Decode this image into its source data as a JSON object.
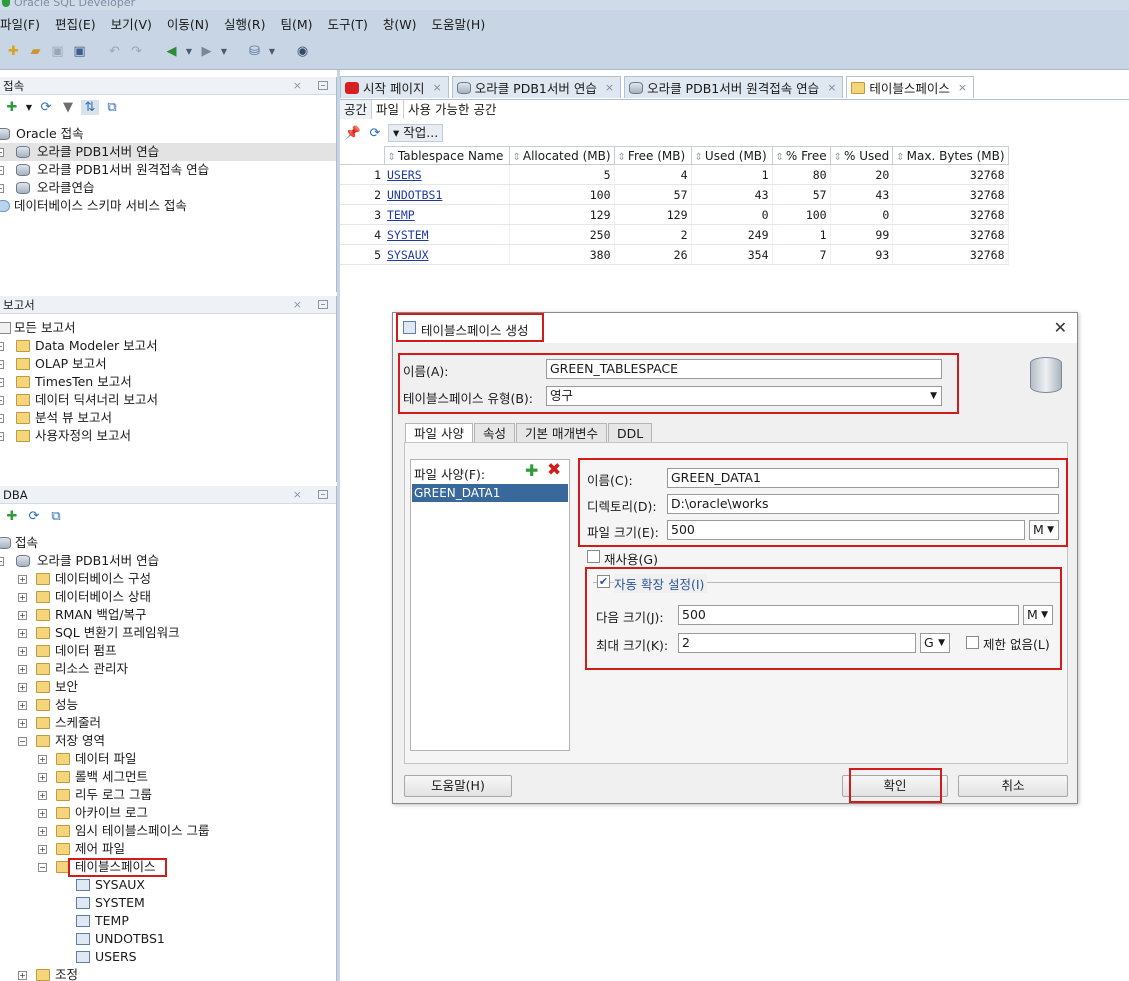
{
  "window": {
    "title": "Oracle SQL Developer"
  },
  "menu": [
    "파일(F)",
    "편집(E)",
    "보기(V)",
    "이동(N)",
    "실행(R)",
    "팀(M)",
    "도구(T)",
    "창(W)",
    "도움말(H)"
  ],
  "connections_panel": {
    "title": "접속",
    "root": "Oracle 접속",
    "items": [
      "오라클 PDB1서버 연습",
      "오라클 PDB1서버 원격접속 연습",
      "오라클연습"
    ],
    "cloud": "데이터베이스 스키마 서비스 접속"
  },
  "reports_panel": {
    "title": "보고서",
    "root": "모든 보고서",
    "items": [
      "Data Modeler 보고서",
      "OLAP 보고서",
      "TimesTen 보고서",
      "데이터 딕셔너리 보고서",
      "분석 뷰 보고서",
      "사용자정의 보고서"
    ]
  },
  "dba_panel": {
    "title": "DBA",
    "root": "접속",
    "connection": "오라클 PDB1서버 연습",
    "items": [
      "데이터베이스 구성",
      "데이터베이스 상태",
      "RMAN 백업/복구",
      "SQL 변환기 프레임워크",
      "데이터 펌프",
      "리소스 관리자",
      "보안",
      "성능",
      "스케줄러",
      "저장 영역"
    ],
    "storage_items": [
      "데이터 파일",
      "롤백 세그먼트",
      "리두 로그 그룹",
      "아카이브 로그",
      "임시 테이블스페이스 그룹",
      "제어 파일",
      "테이블스페이스"
    ],
    "tablespaces": [
      "SYSAUX",
      "SYSTEM",
      "TEMP",
      "UNDOTBS1",
      "USERS"
    ],
    "last": "조정"
  },
  "editor_tabs": [
    "시작 페이지",
    "오라클 PDB1서버 연습",
    "오라클 PDB1서버 원격접속 연습",
    "테이블스페이스"
  ],
  "sub_tabs": [
    "공간",
    "파일",
    "사용 가능한 공간"
  ],
  "grid_actions": {
    "label": "작업..."
  },
  "tablespace_grid": {
    "columns": [
      "Tablespace Name",
      "Allocated (MB)",
      "Free (MB)",
      "Used (MB)",
      "% Free",
      "% Used",
      "Max. Bytes (MB)"
    ],
    "rows": [
      [
        "1",
        "USERS",
        "5",
        "4",
        "1",
        "80",
        "20",
        "32768"
      ],
      [
        "2",
        "UNDOTBS1",
        "100",
        "57",
        "43",
        "57",
        "43",
        "32768"
      ],
      [
        "3",
        "TEMP",
        "129",
        "129",
        "0",
        "100",
        "0",
        "32768"
      ],
      [
        "4",
        "SYSTEM",
        "250",
        "2",
        "249",
        "1",
        "99",
        "32768"
      ],
      [
        "5",
        "SYSAUX",
        "380",
        "26",
        "354",
        "7",
        "93",
        "32768"
      ]
    ]
  },
  "dialog": {
    "title": "테이블스페이스 생성",
    "name_label": "이름(A):",
    "name_value": "GREEN_TABLESPACE",
    "type_label": "테이블스페이스 유형(B):",
    "type_value": "영구",
    "tabs": [
      "파일 사양",
      "속성",
      "기본 매개변수",
      "DDL"
    ],
    "file_spec_label": "파일 사양(F):",
    "file_item": "GREEN_DATA1",
    "file_name_label": "이름(C):",
    "file_name_value": "GREEN_DATA1",
    "dir_label": "디렉토리(D):",
    "dir_value": "D:\\oracle\\works",
    "size_label": "파일 크기(E):",
    "size_value": "500",
    "size_unit": "M",
    "reuse_label": "재사용(G)",
    "autoextend_label": "자동 확장 설정(I)",
    "next_label": "다음 크기(J):",
    "next_value": "500",
    "next_unit": "M",
    "max_label": "최대 크기(K):",
    "max_value": "2",
    "max_unit": "G",
    "unlimited_label": "제한 없음(L)",
    "help_button": "도움말(H)",
    "ok_button": "확인",
    "cancel_button": "취소"
  },
  "colors": {
    "highlight": "#d21b1b",
    "selection": "#39699a",
    "band": "#c7d5e5"
  }
}
